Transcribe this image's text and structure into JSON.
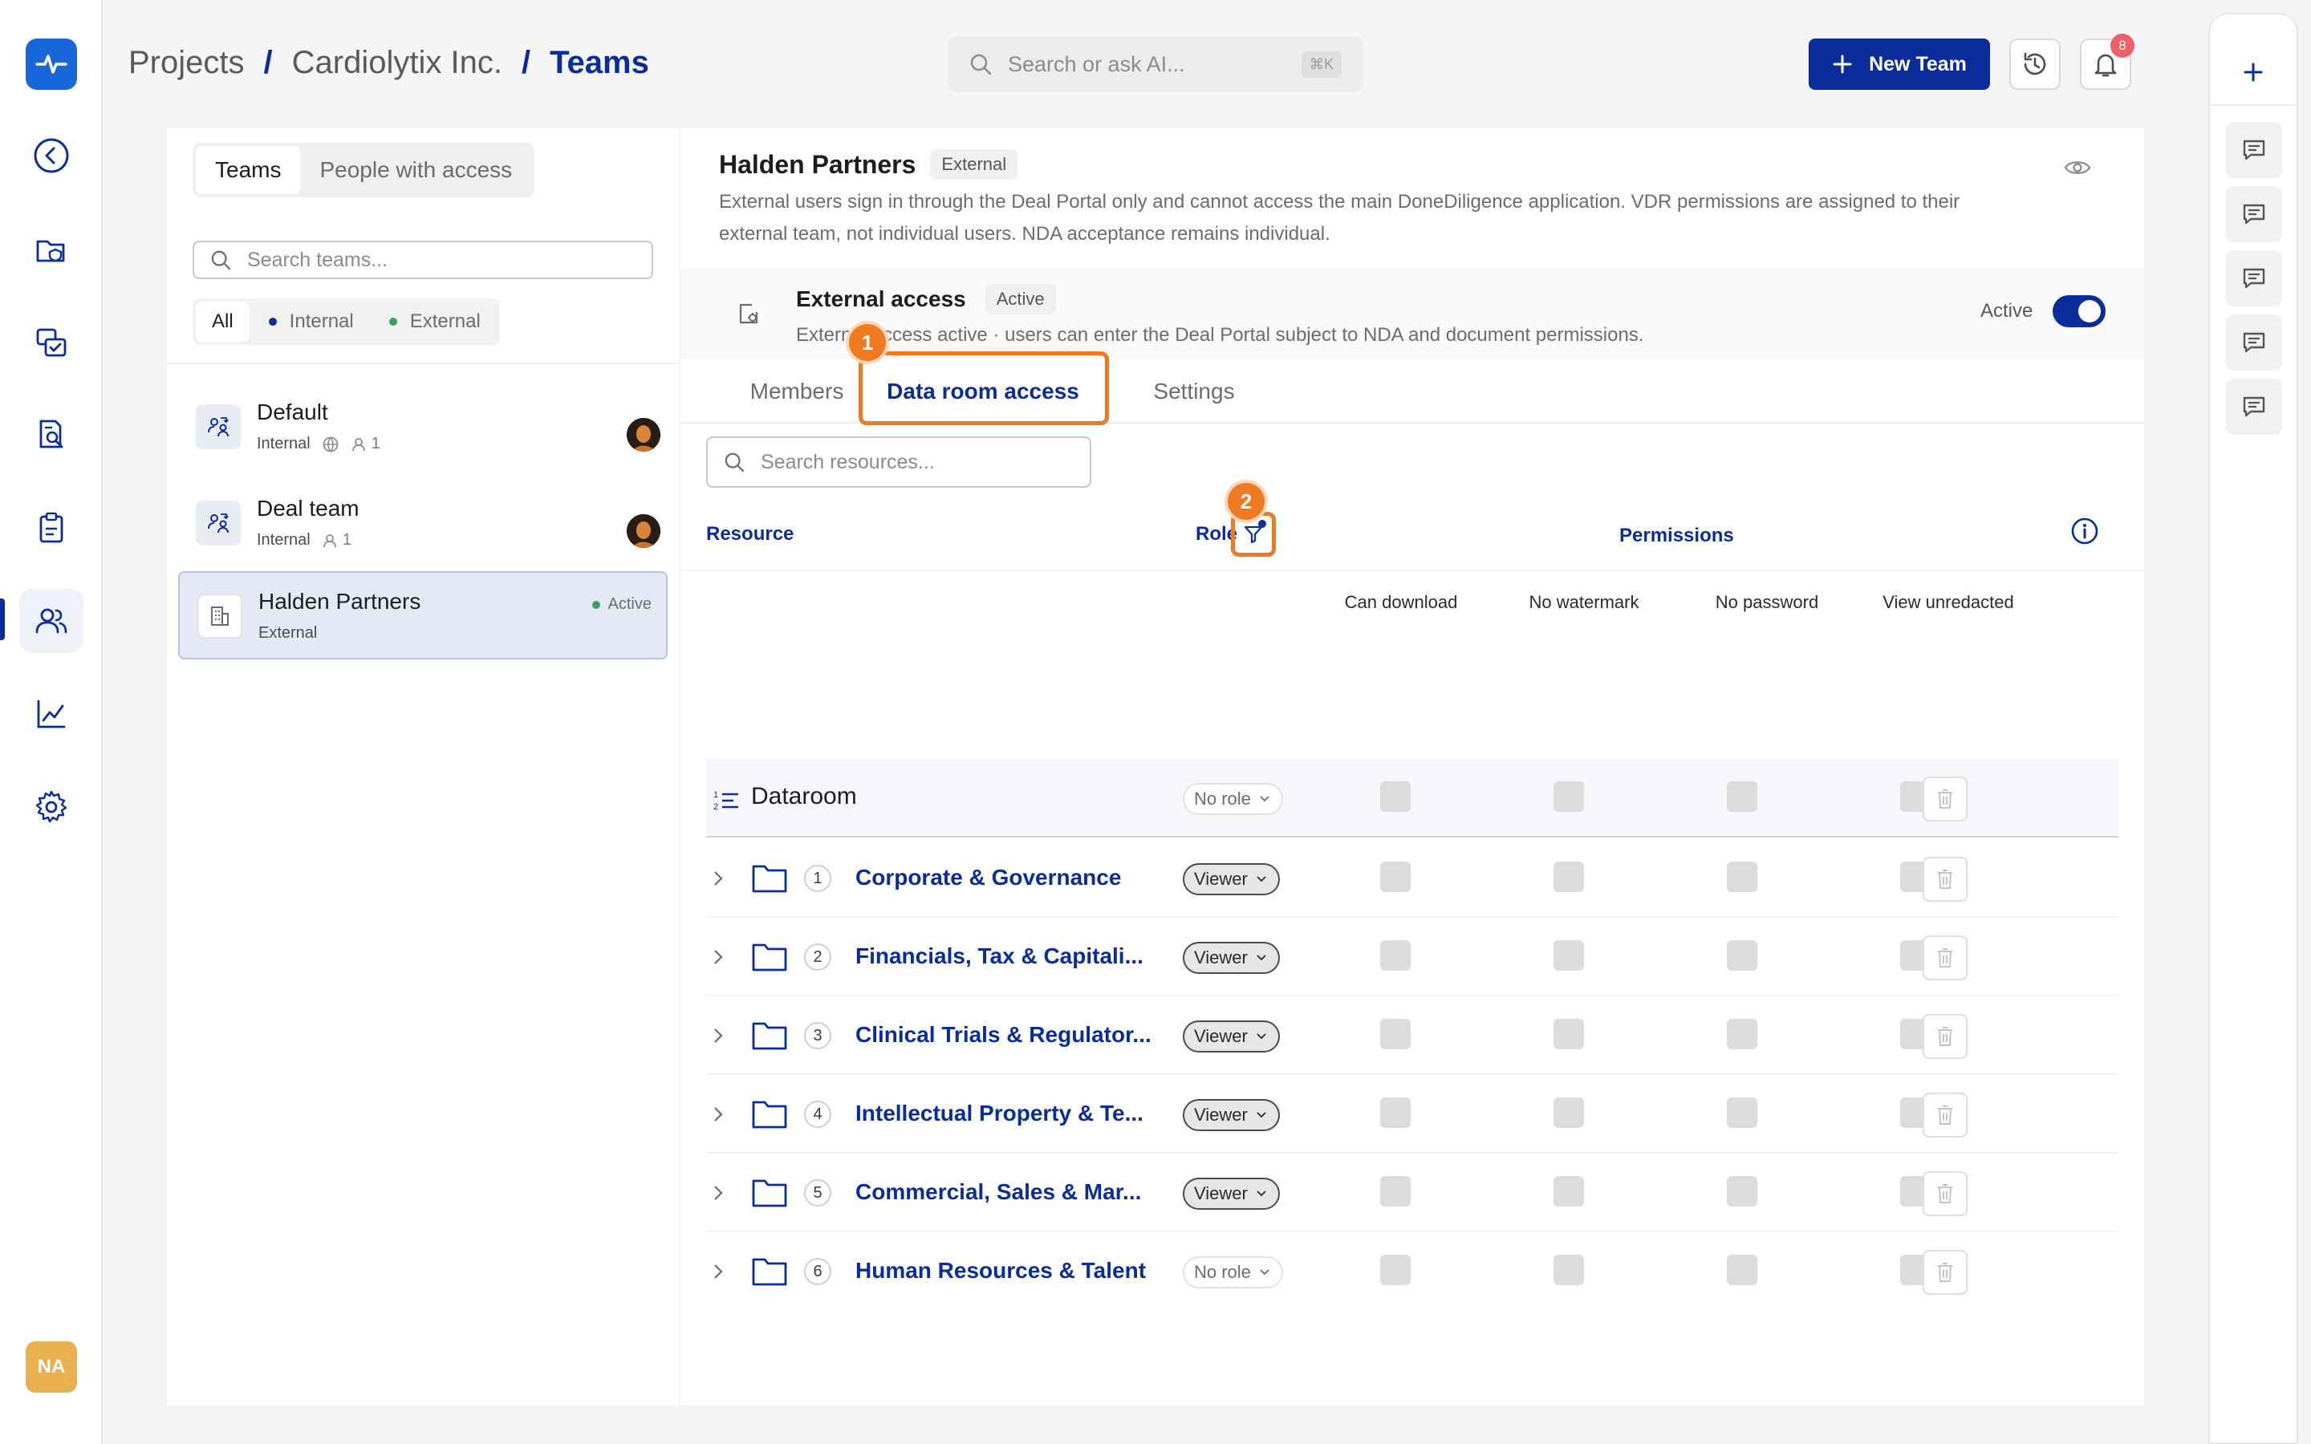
{
  "brand": {
    "accent": "#0b2d9c",
    "logo_bg": "#1767d8",
    "highlight": "#f07a22"
  },
  "rail": {
    "items": [
      {
        "icon": "back-arrow-icon"
      },
      {
        "icon": "folder-shield-icon"
      },
      {
        "icon": "chat-check-icon"
      },
      {
        "icon": "document-search-icon"
      },
      {
        "icon": "clipboard-icon"
      },
      {
        "icon": "users-icon",
        "active": true
      },
      {
        "icon": "chart-icon"
      },
      {
        "icon": "gear-icon"
      }
    ],
    "user_initials": "NA"
  },
  "header": {
    "breadcrumb": [
      "Projects",
      "Cardiolytix Inc.",
      "Teams"
    ],
    "separator": "/",
    "search_placeholder": "Search or ask AI...",
    "search_shortcut": "⌘K",
    "new_team_label": "New Team",
    "notification_count": "8"
  },
  "teams_panel": {
    "tabs": [
      "Teams",
      "People with access"
    ],
    "active_tab": "Teams",
    "search_placeholder": "Search teams...",
    "filters": [
      {
        "label": "All"
      },
      {
        "label": "Internal",
        "color": "#0b2d9c"
      },
      {
        "label": "External",
        "color": "#3aa35b"
      }
    ],
    "teams": [
      {
        "name": "Default",
        "type": "Internal",
        "members": "1"
      },
      {
        "name": "Deal team",
        "type": "Internal",
        "members": "1"
      },
      {
        "name": "Halden Partners",
        "type": "External",
        "status": "Active",
        "selected": true
      }
    ]
  },
  "team_detail": {
    "name": "Halden Partners",
    "tag": "External",
    "description": "External users sign in through the Deal Portal only and cannot access the main DoneDiligence application. VDR permissions are assigned to their external team, not individual users. NDA acceptance remains individual.",
    "external_access": {
      "title": "External access",
      "status": "Active",
      "subtitle": "External access active · users can enter the Deal Portal subject to NDA and document permissions.",
      "toggle_label": "Active",
      "toggle_on": true
    },
    "tabs": [
      "Members",
      "Data room access",
      "Settings"
    ],
    "active_tab": "Data room access",
    "steps": [
      "1",
      "2"
    ],
    "resource_search_placeholder": "Search resources...",
    "columns": {
      "resource": "Resource",
      "role": "Role",
      "permissions": "Permissions"
    },
    "permission_columns": [
      "Can download",
      "No watermark",
      "No password",
      "View unredacted"
    ],
    "dataroom": {
      "name": "Dataroom",
      "role": "No role"
    },
    "folders": [
      {
        "num": "1",
        "name": "Corporate & Governance",
        "role": "Viewer"
      },
      {
        "num": "2",
        "name": "Financials, Tax & Capitali...",
        "role": "Viewer"
      },
      {
        "num": "3",
        "name": "Clinical Trials & Regulator...",
        "role": "Viewer"
      },
      {
        "num": "4",
        "name": "Intellectual Property & Te...",
        "role": "Viewer"
      },
      {
        "num": "5",
        "name": "Commercial, Sales & Mar...",
        "role": "Viewer"
      },
      {
        "num": "6",
        "name": "Human Resources & Talent",
        "role": "No role"
      }
    ]
  }
}
